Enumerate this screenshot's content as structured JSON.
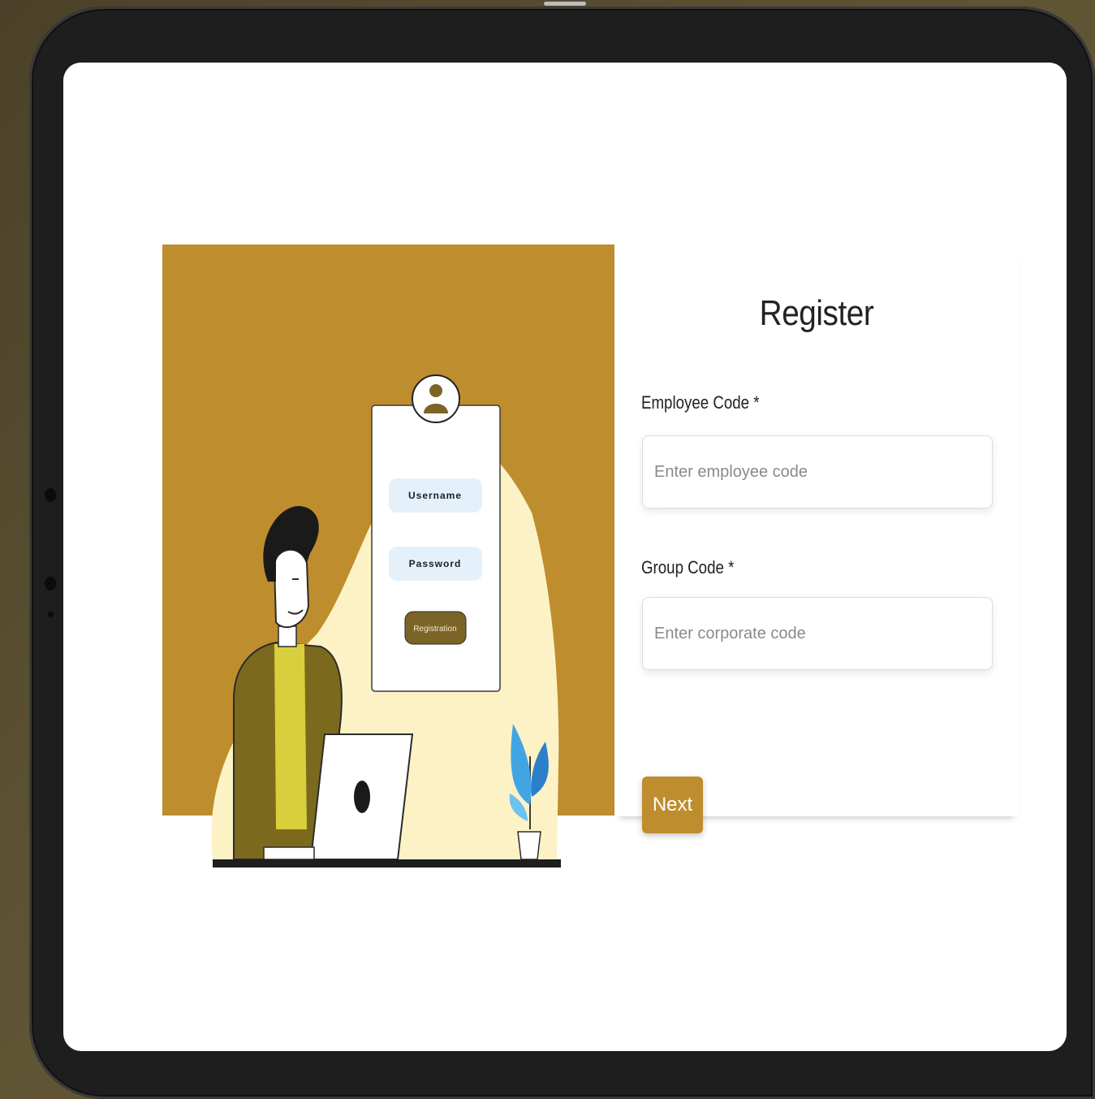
{
  "colors": {
    "accent": "#be8d2e",
    "illustration_background": "#be8d2e",
    "spotlight": "#fdf2c6",
    "jacket": "#7b6a1d",
    "shirt": "#d9cf3c",
    "field_highlight": "#e4f1fb",
    "registration_button": "#7b6426"
  },
  "illustration": {
    "username_label": "Username",
    "password_label": "Password",
    "registration_label": "Registration"
  },
  "form": {
    "title": "Register",
    "employee_code": {
      "label": "Employee Code *",
      "placeholder": "Enter employee code",
      "value": ""
    },
    "group_code": {
      "label": "Group Code *",
      "placeholder": "Enter corporate code",
      "value": ""
    },
    "next_label": "Next"
  }
}
